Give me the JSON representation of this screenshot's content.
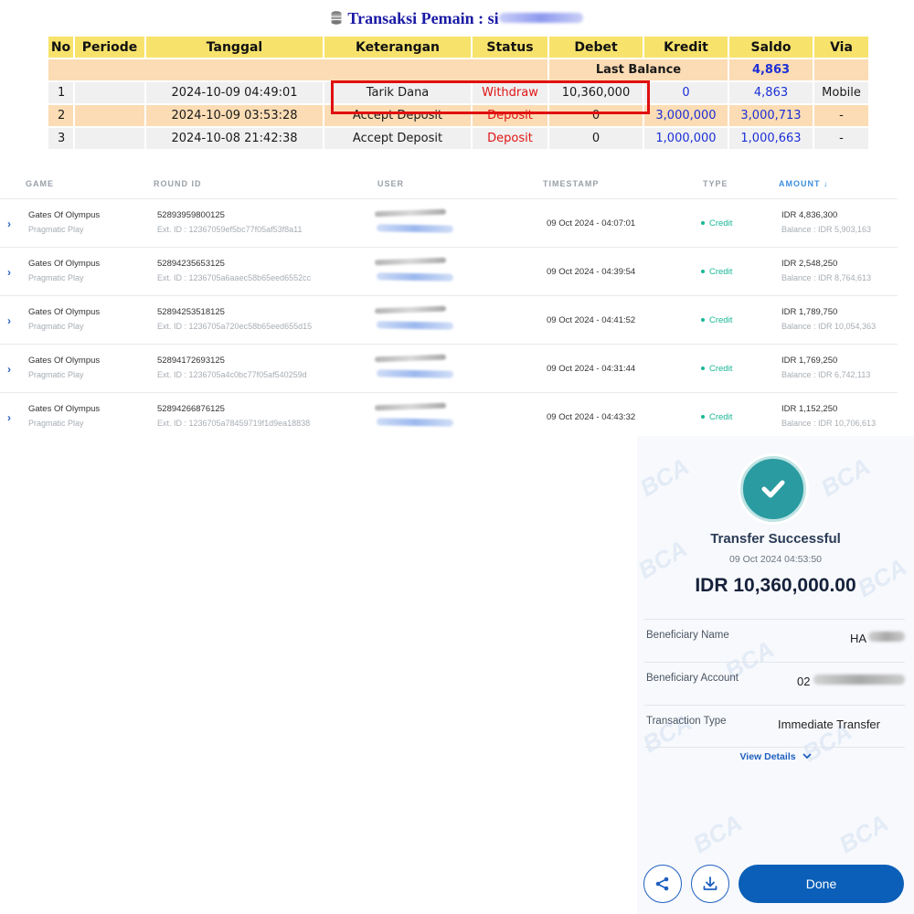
{
  "transactions": {
    "title_prefix": "Transaksi   Pemain : si",
    "headers": [
      "No",
      "Periode",
      "Tanggal",
      "Keterangan",
      "Status",
      "Debet",
      "Kredit",
      "Saldo",
      "Via"
    ],
    "last_balance_label": "Last Balance",
    "last_balance_value": "4,863",
    "rows": [
      {
        "no": "1",
        "periode": "",
        "tanggal": "2024-10-09 04:49:01",
        "keterangan": "Tarik Dana",
        "status": "Withdraw",
        "debet": "10,360,000",
        "kredit": "0",
        "saldo": "4,863",
        "via": "Mobile"
      },
      {
        "no": "2",
        "periode": "",
        "tanggal": "2024-10-09 03:53:28",
        "keterangan": "Accept Deposit",
        "status": "Deposit",
        "debet": "0",
        "kredit": "3,000,000",
        "saldo": "3,000,713",
        "via": "-"
      },
      {
        "no": "3",
        "periode": "",
        "tanggal": "2024-10-08 21:42:38",
        "keterangan": "Accept Deposit",
        "status": "Deposit",
        "debet": "0",
        "kredit": "1,000,000",
        "saldo": "1,000,663",
        "via": "-"
      }
    ]
  },
  "rounds": {
    "headers": {
      "game": "GAME",
      "round_id": "ROUND ID",
      "user": "USER",
      "timestamp": "TIMESTAMP",
      "type": "TYPE",
      "amount": "AMOUNT"
    },
    "rows": [
      {
        "game": "Gates Of Olympus",
        "provider": "Pragmatic Play",
        "round_id": "52893959800125",
        "ext_id": "Ext. ID : 12367059ef5bc77f05af53f8a11",
        "timestamp": "09 Oct 2024 - 04:07:01",
        "type": "Credit",
        "amount": "IDR 4,836,300",
        "balance": "Balance : IDR 5,903,163"
      },
      {
        "game": "Gates Of Olympus",
        "provider": "Pragmatic Play",
        "round_id": "52894235653125",
        "ext_id": "Ext. ID : 1236705a6aaec58b65eed6552cc",
        "timestamp": "09 Oct 2024 - 04:39:54",
        "type": "Credit",
        "amount": "IDR 2,548,250",
        "balance": "Balance : IDR 8,764,613"
      },
      {
        "game": "Gates Of Olympus",
        "provider": "Pragmatic Play",
        "round_id": "52894253518125",
        "ext_id": "Ext. ID : 1236705a720ec58b65eed655d15",
        "timestamp": "09 Oct 2024 - 04:41:52",
        "type": "Credit",
        "amount": "IDR 1,789,750",
        "balance": "Balance : IDR 10,054,363"
      },
      {
        "game": "Gates Of Olympus",
        "provider": "Pragmatic Play",
        "round_id": "52894172693125",
        "ext_id": "Ext. ID : 1236705a4c0bc77f05af540259d",
        "timestamp": "09 Oct 2024 - 04:31:44",
        "type": "Credit",
        "amount": "IDR 1,769,250",
        "balance": "Balance : IDR 6,742,113"
      },
      {
        "game": "Gates Of Olympus",
        "provider": "Pragmatic Play",
        "round_id": "52894266876125",
        "ext_id": "Ext. ID : 1236705a78459719f1d9ea18838",
        "timestamp": "09 Oct 2024 - 04:43:32",
        "type": "Credit",
        "amount": "IDR 1,152,250",
        "balance": "Balance : IDR 10,706,613"
      }
    ]
  },
  "receipt": {
    "watermark": "BCA",
    "title": "Transfer Successful",
    "datetime": "09 Oct 2024 04:53:50",
    "amount": "IDR 10,360,000.00",
    "beneficiary_name_label": "Beneficiary Name",
    "beneficiary_name_value": "HA",
    "beneficiary_account_label": "Beneficiary Account",
    "beneficiary_account_value": "02",
    "transaction_type_label": "Transaction Type",
    "transaction_type_value": "Immediate Transfer",
    "view_details": "View Details",
    "done": "Done"
  },
  "colors": {
    "table_header": "#f7e36b",
    "peach_row": "#fbdcb4",
    "status_red": "#e01515",
    "value_blue": "#1b2fd6",
    "credit_green": "#19b795",
    "bca_blue": "#0b5fb8",
    "check_teal": "#2a9ba0"
  },
  "icons": [
    "database-icon",
    "chevron-right-icon",
    "sort-down-icon",
    "check-icon",
    "share-icon",
    "download-icon",
    "chevron-down-icon"
  ]
}
